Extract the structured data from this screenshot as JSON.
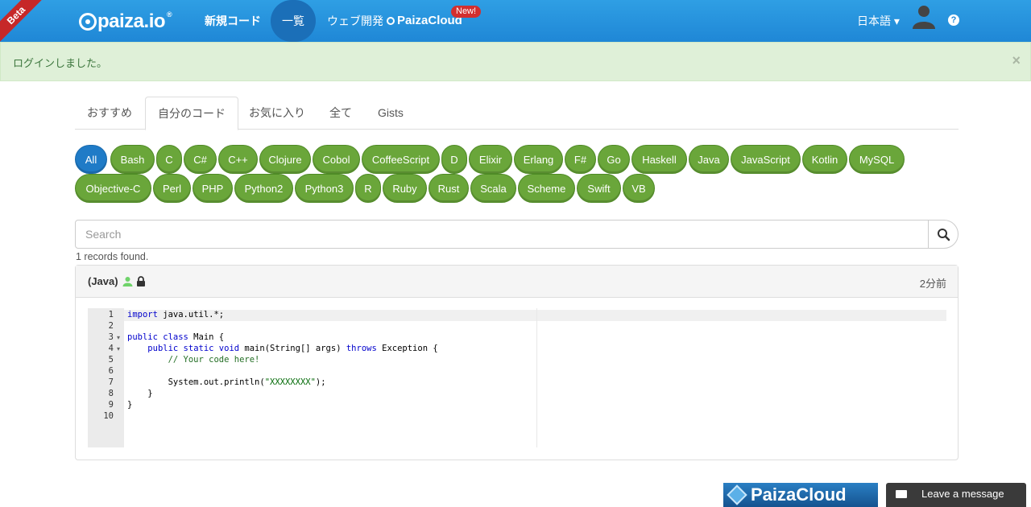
{
  "header": {
    "beta": "Beta",
    "logo": "paiza.io",
    "nav_new_code": "新規コード",
    "nav_list": "一覧",
    "nav_web_dev": "ウェブ開発",
    "nav_cloud": "PaizaCloud",
    "new_badge": "New!",
    "language": "日本語 ▾",
    "help": "?"
  },
  "alert": {
    "message": "ログインしました。",
    "close": "×"
  },
  "tabs": [
    "おすすめ",
    "自分のコード",
    "お気に入り",
    "全て",
    "Gists"
  ],
  "languages_row1": [
    "All",
    "Bash",
    "C",
    "C#",
    "C++",
    "Clojure",
    "Cobol",
    "CoffeeScript",
    "D",
    "Elixir",
    "Erlang",
    "F#",
    "Go",
    "Haskell",
    "Java",
    "JavaScript",
    "Kotlin",
    "MySQL"
  ],
  "languages_row2": [
    "Objective-C",
    "Perl",
    "PHP",
    "Python2",
    "Python3",
    "R",
    "Ruby",
    "Rust",
    "Scala",
    "Scheme",
    "Swift",
    "VB"
  ],
  "search": {
    "placeholder": "Search",
    "records": "1 records found."
  },
  "record": {
    "title": "(Java)",
    "time": "2分前",
    "code_lines": [
      "import java.util.*;",
      "",
      "public class Main {",
      "    public static void main(String[] args) throws Exception {",
      "        // Your code here!",
      "",
      "        System.out.println(\"XXXXXXXX\");",
      "    }",
      "}",
      ""
    ]
  },
  "footer": {
    "paizacloud": "PaizaCloud",
    "leave_message": "Leave a message"
  },
  "colors": {
    "nav_blue": "#1f87d6",
    "pill_green": "#6aa63a",
    "pill_active": "#1f7bc7",
    "alert_bg": "#dff0d8"
  }
}
